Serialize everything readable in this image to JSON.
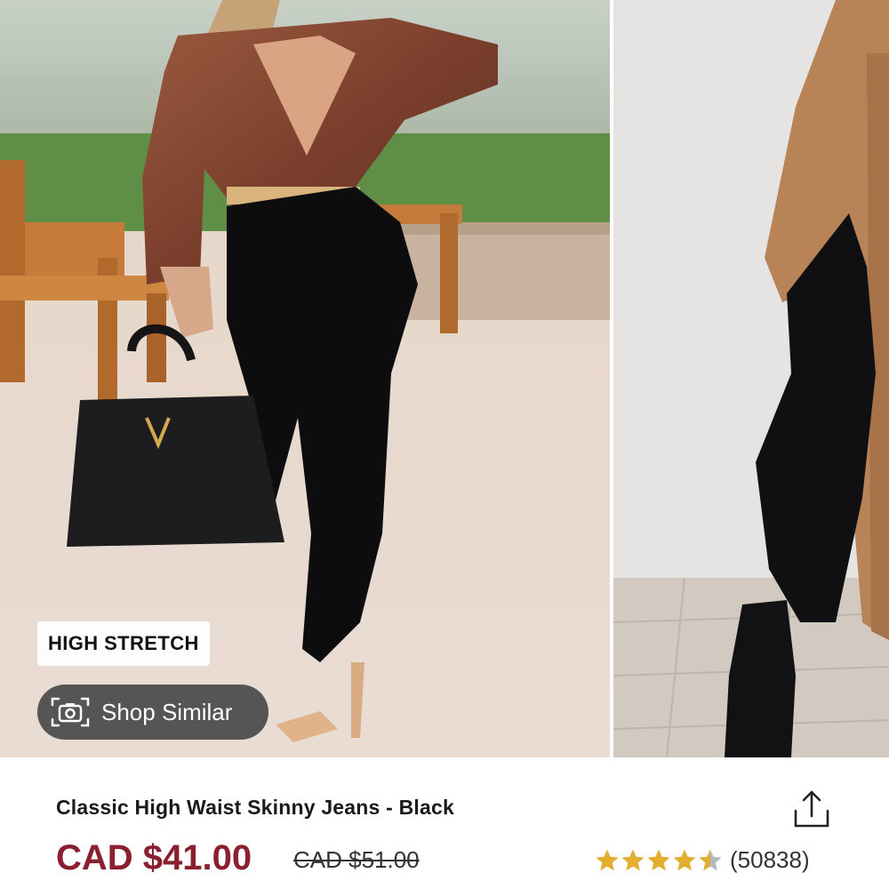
{
  "gallery": {
    "badge": "HIGH STRETCH",
    "shop_similar_label": "Shop Similar"
  },
  "product": {
    "title": "Classic High Waist Skinny Jeans - Black",
    "price": "CAD $41.00",
    "original_price": "CAD $51.00",
    "rating": 4.5,
    "review_count": "(50838)"
  },
  "colors": {
    "price": "#8a1f2e",
    "star": "#e3ad2e",
    "star_empty": "#b3b8c4"
  },
  "icons": {
    "camera": "camera-scan-icon",
    "share": "share-icon",
    "star": "star-icon"
  }
}
